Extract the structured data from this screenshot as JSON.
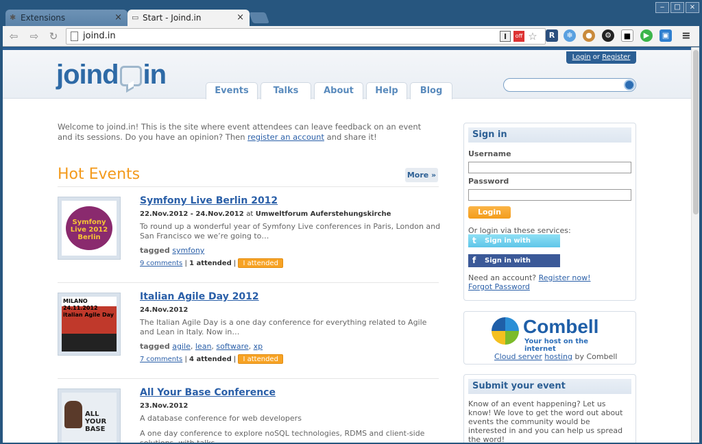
{
  "browser": {
    "tabs": [
      {
        "label": "Extensions",
        "icon": "puzzle-icon"
      },
      {
        "label": "Start - Joind.in",
        "icon": "page-icon"
      }
    ],
    "url": "joind.in",
    "close_glyph": "×",
    "window_buttons": [
      "‒",
      "□",
      "×"
    ]
  },
  "header": {
    "logo_left": "joind",
    "logo_right": "in",
    "login_link": "Login",
    "or_text": "or",
    "register_link": "Register",
    "nav": [
      "Events",
      "Talks",
      "About",
      "Help",
      "Blog"
    ]
  },
  "welcome": {
    "text_before": "Welcome to joind.in! This is the site where event attendees can leave feedback on an event and its sessions. Do you have an opinion? Then ",
    "link": "register an account",
    "text_after": " and share it!"
  },
  "hot_events": {
    "title": "Hot Events",
    "more": "More »",
    "events": [
      {
        "title": "Symfony Live Berlin 2012",
        "date": "22.Nov.2012 - 24.Nov.2012",
        "at": "at",
        "venue": "Umweltforum Auferstehungskirche",
        "description": "To round up a wonderful year of Symfony Live conferences in Paris, London and San Francisco we we’re going to…",
        "tagged_label": "tagged",
        "tags": [
          "symfony"
        ],
        "comments": "9 comments",
        "attended": "1 attended",
        "attend_button": "I attended",
        "thumb_text": "Symfony Live 2012 Berlin"
      },
      {
        "title": "Italian Agile Day 2012",
        "date": "24.Nov.2012",
        "at": "",
        "venue": "",
        "description": "The Italian Agile Day is a one day conference for everything related to Agile and Lean in Italy. Now in…",
        "tagged_label": "tagged",
        "tags": [
          "agile",
          "lean",
          "software",
          "xp"
        ],
        "comments": "7 comments",
        "attended": "4 attended",
        "attend_button": "I attended",
        "thumb_text": "MILANO 24.11.2012 italian Agile Day"
      },
      {
        "title": "All Your Base Conference",
        "date": "23.Nov.2012",
        "description": "A database conference for web developers",
        "description2": "A one day conference to explore noSQL technologies, RDMS and client-side solutions, with talks…",
        "thumb_text": "ALL YOUR BASE"
      }
    ]
  },
  "signin": {
    "title": "Sign in",
    "username_label": "Username",
    "password_label": "Password",
    "login_button": "Login",
    "services_text": "Or login via these services:",
    "twitter": "Sign in with Twitter",
    "facebook": "Sign in with Facebook",
    "need_account": "Need an account?",
    "register_now": "Register now!",
    "forgot": "Forgot Password"
  },
  "sponsor": {
    "brand": "Combell",
    "tagline": "Your host on the internet",
    "line_link1": "Cloud server",
    "line_link2": "hosting",
    "line_suffix": "by Combell"
  },
  "submit": {
    "title": "Submit your event",
    "text": "Know of an event happening? Let us know! We love to get the word out about events the community would be interested in and you can help us spread the word!"
  },
  "colors": {
    "brand_blue": "#2e6aa6",
    "orange": "#f39a1c",
    "link": "#2a5fa8"
  }
}
